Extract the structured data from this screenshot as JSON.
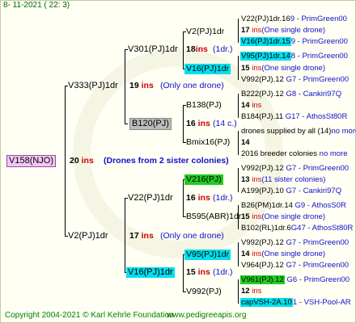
{
  "header": "8- 11-2021 ( 22: 3)",
  "footer": {
    "copyright": "Copyright 2004-2021 © Karl Kehrle Foundation",
    "site": "www.pedigreeapis.org"
  },
  "root": {
    "name": "V158(NJO)",
    "count": "20",
    "unit": "ins",
    "note": "(Drones from 2 sister colonies)"
  },
  "gen1": [
    {
      "name": "V333(PJ)1dr",
      "count": "19",
      "unit": "ins",
      "note": "(Only one drone)"
    },
    {
      "name": "V2(PJ)1dr",
      "count": "17",
      "unit": "ins",
      "note": "(Only one drone)"
    }
  ],
  "gen2": [
    {
      "name": "V301(PJ)1dr",
      "count": "18",
      "unit": "ins",
      "note": "(1dr.)"
    },
    {
      "name": "B120(PJ)",
      "count": "16",
      "unit": "ins",
      "note": "(14 c.)"
    },
    {
      "name": "V22(PJ)1dr",
      "count": "16",
      "unit": "ins",
      "note": "(1dr.)"
    },
    {
      "name": "V16(PJ)1dr",
      "count": "15",
      "unit": "ins",
      "note": "(1dr.)"
    }
  ],
  "gen3": [
    {
      "name": "V2(PJ)1dr"
    },
    {
      "name": "V16(PJ)1dr"
    },
    {
      "name": "B138(PJ)"
    },
    {
      "name": "Bmix16(PJ)"
    },
    {
      "name": "V216(PJ)"
    },
    {
      "name": "B595(ABR)1dr"
    },
    {
      "name": "V95(PJ)1dr"
    },
    {
      "name": "V992(PJ)"
    }
  ],
  "gen4": [
    {
      "top": "V22(PJ)1dr.16",
      "top_suffix": "9 - PrimGreen00",
      "count": "17",
      "unit": "ins",
      "note": "(One single drone)",
      "bottom": "V16(PJ)1dr.15",
      "bottom_suffix": "9 - PrimGreen00"
    },
    {
      "top": "V95(PJ)1dr.14",
      "top_suffix": "8 - PrimGreen00",
      "count": "15",
      "unit": "ins",
      "note": "(One single drone)",
      "bottom": "V992(PJ).12",
      "bottom_suffix": "G7 - PrimGreen00"
    },
    {
      "top": "B222(PJ).12",
      "top_suffix": "G8 - Cankiri97Q",
      "count": "14",
      "unit": "ins",
      "note": "",
      "bottom": "B184(PJ).11",
      "bottom_suffix": "G17 - AthosSt80R"
    },
    {
      "top": "drones supplied by all (14)",
      "top_suffix": "no more",
      "count": "14",
      "unit": "",
      "note": "",
      "bottom": "2016 breeder colonies",
      "bottom_suffix": "no more"
    },
    {
      "top": "V992(PJ).12",
      "top_suffix": "G7 - PrimGreen00",
      "count": "13",
      "unit": "ins",
      "note": "(11 sister colonies)",
      "bottom": "A199(PJ).10",
      "bottom_suffix": "G7 - Cankiri97Q"
    },
    {
      "top": "B26(PM)1dr.14",
      "top_suffix": "G9 - AthosS0R",
      "count": "15",
      "unit": "ins",
      "note": "(One single drone)",
      "bottom": "B102(RL)1dr.6",
      "bottom_suffix": "G47 - AthosSt80R"
    },
    {
      "top": "V992(PJ).12",
      "top_suffix": "G7 - PrimGreen00",
      "count": "14",
      "unit": "ins",
      "note": "(One single drone)",
      "bottom": "V964(PJ).12",
      "bottom_suffix": "G7 - PrimGreen00"
    },
    {
      "top": "V961(PJ).12",
      "top_suffix": "G6 - PrimGreen00",
      "count": "12",
      "unit": "ins",
      "note": "",
      "bottom": "capVSH-2A.10",
      "bottom_suffix": "1 - VSH-Pool-AR"
    }
  ]
}
